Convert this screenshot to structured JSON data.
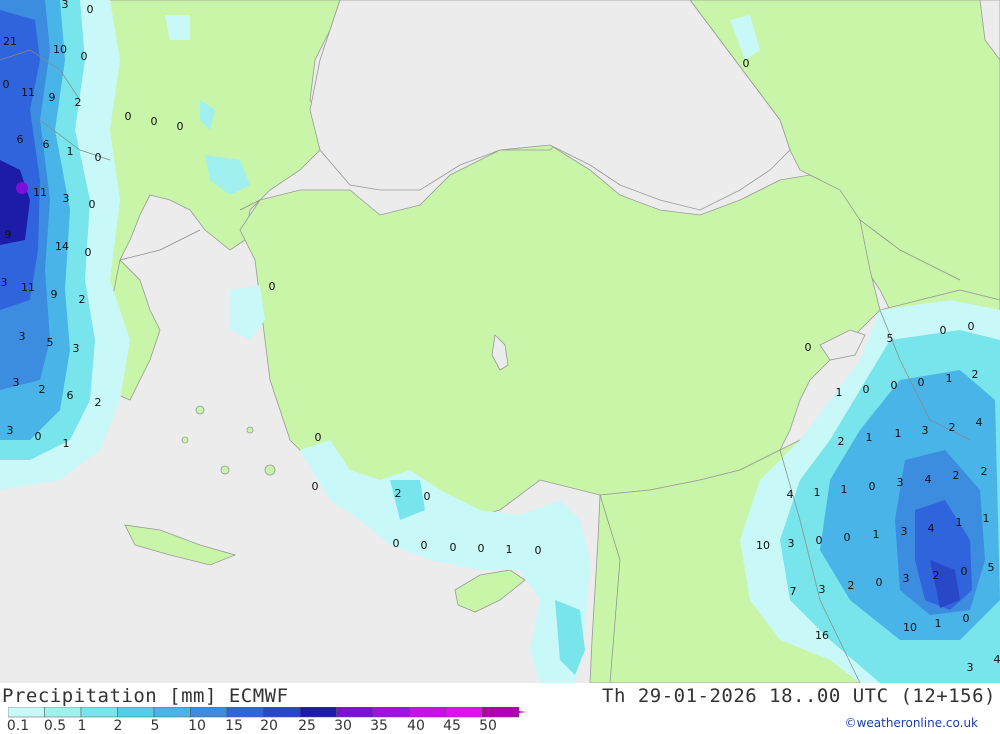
{
  "header": {
    "title_left": "Precipitation [mm] ECMWF",
    "title_right": "Th 29-01-2026 18..00 UTC (12+156)"
  },
  "legend": {
    "labels": [
      "0.1",
      "0.5",
      "1",
      "2",
      "5",
      "10",
      "15",
      "20",
      "25",
      "30",
      "35",
      "40",
      "45",
      "50"
    ],
    "colors": [
      "#c8f8f8",
      "#a0f0f0",
      "#78e4ec",
      "#50d0e8",
      "#48b4e8",
      "#3c8ce0",
      "#3064dc",
      "#2848c8",
      "#1c1ca8",
      "#7c10d8",
      "#a010e0",
      "#c810e8",
      "#e010f0",
      "#b000b0"
    ]
  },
  "credit": "©weatheronline.co.uk",
  "map_colors": {
    "sea": "#ececec",
    "land": "#c8f5a8",
    "border": "#999999"
  },
  "map_values": [
    {
      "t": "3"
    },
    {
      "t": "0"
    },
    {
      "t": "21"
    },
    {
      "t": "10"
    },
    {
      "t": "0"
    },
    {
      "t": "0"
    },
    {
      "t": "11"
    },
    {
      "t": "9"
    },
    {
      "t": "2"
    },
    {
      "t": "0"
    },
    {
      "t": "0"
    },
    {
      "t": "0"
    },
    {
      "t": "6"
    },
    {
      "t": "6"
    },
    {
      "t": "1"
    },
    {
      "t": "0"
    },
    {
      "t": "11"
    },
    {
      "t": "3"
    },
    {
      "t": "0"
    },
    {
      "t": "9"
    },
    {
      "t": "14"
    },
    {
      "t": "0"
    },
    {
      "t": "3"
    },
    {
      "t": "11"
    },
    {
      "t": "9"
    },
    {
      "t": "2"
    },
    {
      "t": "0"
    },
    {
      "t": "3"
    },
    {
      "t": "5"
    },
    {
      "t": "3"
    },
    {
      "t": "3"
    },
    {
      "t": "2"
    },
    {
      "t": "6"
    },
    {
      "t": "2"
    },
    {
      "t": "3"
    },
    {
      "t": "0"
    },
    {
      "t": "1"
    },
    {
      "t": "0"
    },
    {
      "t": "0"
    },
    {
      "t": "2"
    },
    {
      "t": "0"
    },
    {
      "t": "0"
    },
    {
      "t": "0"
    },
    {
      "t": "0"
    },
    {
      "t": "0"
    },
    {
      "t": "1"
    },
    {
      "t": "0"
    },
    {
      "t": "0"
    },
    {
      "t": "0"
    },
    {
      "t": "5"
    },
    {
      "t": "0"
    },
    {
      "t": "0"
    },
    {
      "t": "1"
    },
    {
      "t": "0"
    },
    {
      "t": "0"
    },
    {
      "t": "0"
    },
    {
      "t": "1"
    },
    {
      "t": "2"
    },
    {
      "t": "2"
    },
    {
      "t": "2"
    },
    {
      "t": "1"
    },
    {
      "t": "1"
    },
    {
      "t": "3"
    },
    {
      "t": "4"
    },
    {
      "t": "4"
    },
    {
      "t": "1"
    },
    {
      "t": "1"
    },
    {
      "t": "0"
    },
    {
      "t": "3"
    },
    {
      "t": "4"
    },
    {
      "t": "2"
    },
    {
      "t": "2"
    },
    {
      "t": "10"
    },
    {
      "t": "3"
    },
    {
      "t": "0"
    },
    {
      "t": "0"
    },
    {
      "t": "1"
    },
    {
      "t": "3"
    },
    {
      "t": "4"
    },
    {
      "t": "1"
    },
    {
      "t": "1"
    },
    {
      "t": "7"
    },
    {
      "t": "3"
    },
    {
      "t": "2"
    },
    {
      "t": "0"
    },
    {
      "t": "3"
    },
    {
      "t": "2"
    },
    {
      "t": "0"
    },
    {
      "t": "5"
    },
    {
      "t": "16"
    },
    {
      "t": "10"
    },
    {
      "t": "1"
    },
    {
      "t": "0"
    },
    {
      "t": "3"
    },
    {
      "t": "4"
    },
    {
      "t": "1"
    },
    {
      "t": "2"
    },
    {
      "t": "3"
    }
  ]
}
